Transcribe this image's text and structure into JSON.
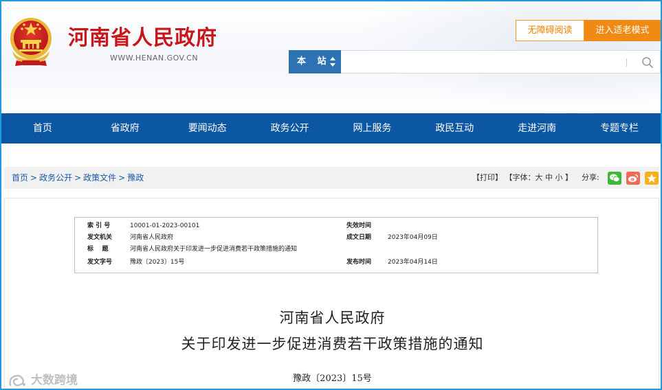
{
  "header": {
    "site_title": "河南省人民政府",
    "site_url": "WWW.HENAN.GOV.CN",
    "accessibility_button": "无障碍阅读",
    "elderly_mode_button": "进入适老模式",
    "search": {
      "scope_label": "本 站",
      "placeholder": ""
    }
  },
  "nav": {
    "items": [
      {
        "label": "首页"
      },
      {
        "label": "省政府"
      },
      {
        "label": "要闻动态"
      },
      {
        "label": "政务公开"
      },
      {
        "label": "网上服务"
      },
      {
        "label": "政民互动"
      },
      {
        "label": "走进河南"
      },
      {
        "label": "专题专栏"
      }
    ]
  },
  "breadcrumb": {
    "items": [
      "首页",
      "政务公开",
      "政策文件",
      "豫政"
    ],
    "separator": ">"
  },
  "tools": {
    "print": "【打印】",
    "font_prefix": "【字体：",
    "font_large": "大",
    "font_medium": "中",
    "font_small": "小",
    "font_suffix": "】",
    "share_label": "分享:",
    "share_icons": [
      "wechat-icon",
      "weibo-icon",
      "qzone-icon"
    ],
    "share_colors": {
      "wechat": "#3fb838",
      "weibo": "#ef6b57",
      "qzone": "#f5b21b"
    }
  },
  "meta": {
    "index_no_label": "索 引 号",
    "index_no": "10001-01-2023-00101",
    "expiry_label": "失效时间",
    "expiry": "",
    "issuer_label": "发文机关",
    "issuer": "河南省人民政府",
    "title_label": "标    题",
    "title": "河南省人民政府关于印发进一步促进消费若干政策措施的通知",
    "created_label": "成文日期",
    "created": "2023年04月09日",
    "doc_no_label": "发文字号",
    "doc_no": "豫政〔2023〕15号",
    "published_label": "发布时间",
    "published": "2023年04月14日"
  },
  "document": {
    "title_line1": "河南省人民政府",
    "title_line2": "关于印发进一步促进消费若干政策措施的通知",
    "number": "豫政〔2023〕15号"
  },
  "watermark": "大数跨境",
  "colors": {
    "nav_bg": "#0c57a3",
    "brand_red": "#c8161d",
    "accent_orange": "#f08a12",
    "search_scope_bg": "#2d73b4",
    "frame_border": "#1e9be3"
  }
}
